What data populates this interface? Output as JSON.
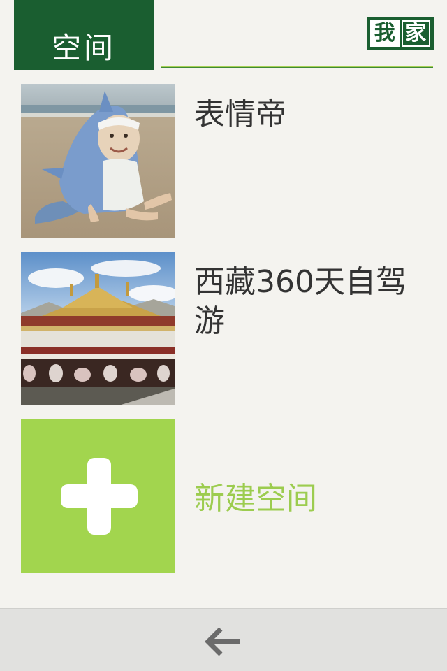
{
  "header": {
    "tab_label": "空间",
    "logo_text": "我家",
    "logo_glyph_1": "我",
    "logo_glyph_2": "家"
  },
  "spaces": [
    {
      "title": "表情帝",
      "thumbnail": "baby-in-shark-costume-photo"
    },
    {
      "title": "西藏360天自驾游",
      "thumbnail": "tibetan-temple-photo"
    }
  ],
  "new_space": {
    "label": "新建空间",
    "icon": "plus-icon"
  },
  "bottom_bar": {
    "back_icon": "back-arrow-icon"
  },
  "colors": {
    "background": "#f4f3ef",
    "header_green": "#1a5e30",
    "accent_lime": "#a2d54e",
    "new_space_text": "#9ccc4f",
    "title_text": "#333333",
    "bottom_bar": "#e1e1df",
    "back_arrow": "#6b6b6b"
  }
}
